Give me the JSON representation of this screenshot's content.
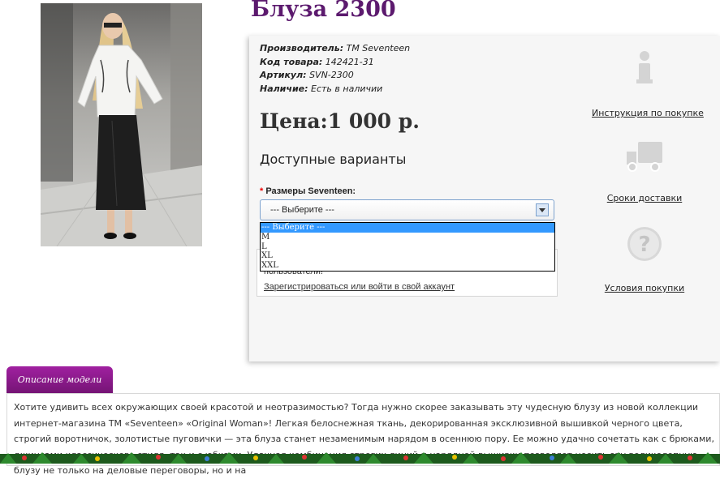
{
  "product": {
    "title": "Блуза 2300",
    "specs": [
      {
        "label": "Производитель:",
        "value": "TM Seventeen"
      },
      {
        "label": "Код товара:",
        "value": "142421-31"
      },
      {
        "label": "Артикул:",
        "value": "SVN-2300"
      },
      {
        "label": "Наличие:",
        "value": "Есть в наличии"
      }
    ],
    "price": "Цена:1 000 р.",
    "variants_heading": "Доступные варианты",
    "size_label": "Размеры Seventeen:",
    "required_mark": "*",
    "size_select_value": "--- Выберите ---",
    "size_options": [
      "--- Выберите ---",
      "M",
      "L",
      "XL",
      "XXL"
    ]
  },
  "notice": {
    "text": "пользователи!",
    "link": "Зарегистрироваться или войти в свой аккаунт"
  },
  "sidebar": {
    "items": [
      {
        "label": "Инструкция по покупке",
        "icon": "info-icon"
      },
      {
        "label": "Сроки доставки",
        "icon": "truck-icon"
      },
      {
        "label": "Условия покупки",
        "icon": "question-icon"
      }
    ]
  },
  "description": {
    "tab_label": "Описание модели",
    "text": "Хотите удивить всех окружающих своей красотой и неотразимостью? Тогда нужно скорее заказывать эту чудесную блузу из новой коллекции интернет-магазина ТМ «Seventeen» «Original Woman»! Легкая белоснежная ткань, декорированная эксклюзивной вышивкой черного цвета, строгий воротничок, золотистые пуговички — эта блуза станет незаменимым нарядом в осеннюю пору. Ее можно удачно сочетать как с брюками, джинсами классического стиля, так и с юбками. Удачная комбинация строгих линий и нарядной вышивки позволяет носить эту великолепную блузу не только на деловые переговоры, но и на"
  },
  "colors": {
    "title": "#5c1a6e",
    "tab": "#8a1a8a",
    "selected_option": "#3399ff"
  }
}
